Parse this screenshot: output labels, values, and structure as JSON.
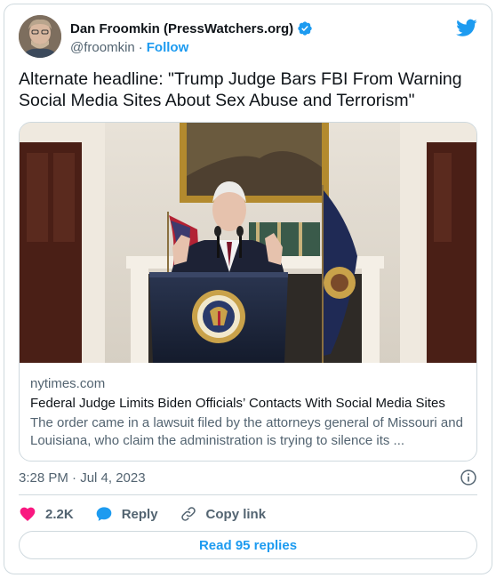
{
  "author": {
    "name": "Dan Froomkin (PressWatchers.org)",
    "handle": "@froomkin",
    "separator": "·",
    "follow_label": "Follow"
  },
  "tweet": {
    "text": "Alternate headline: \"Trump Judge Bars FBI From Warning Social Media Sites About  Sex Abuse and Terrorism\""
  },
  "card": {
    "domain": "nytimes.com",
    "title": "Federal Judge Limits Biden Officials’ Contacts With Social Media Sites",
    "description": "The order came in a lawsuit filed by the attorneys general of Missouri and Louisiana, who claim the administration is trying to silence its ..."
  },
  "timestamp": "3:28 PM · Jul 4, 2023",
  "actions": {
    "likes": "2.2K",
    "reply_label": "Reply",
    "copy_link_label": "Copy link"
  },
  "replies_button": "Read 95 replies",
  "icons": {
    "verified": "verified-badge-icon",
    "brand": "twitter-bird-icon",
    "info": "info-icon",
    "like": "heart-icon",
    "reply": "speech-bubble-icon",
    "copy": "link-icon"
  },
  "colors": {
    "accent": "#1d9bf0",
    "like": "#f91880",
    "text_primary": "#0f1419",
    "text_secondary": "#536471",
    "border": "#cfd9de"
  }
}
